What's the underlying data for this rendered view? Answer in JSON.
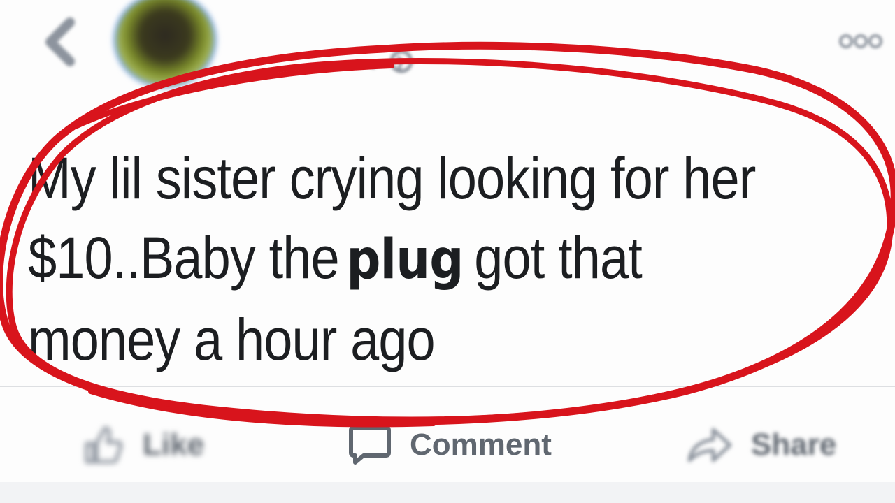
{
  "post": {
    "line1": "My lil sister crying looking for her",
    "line2_before": "$10..Baby the",
    "line2_emphasis": "plug",
    "line2_after": "got that",
    "line3": "money a hour ago"
  },
  "actions": {
    "like_label": "Like",
    "comment_label": "Comment",
    "share_label": "Share"
  },
  "icons": {
    "back": "chevron-left-icon",
    "avatar": "avatar",
    "audience": "globe-icon",
    "more": "more-icon",
    "like": "thumbs-up-icon",
    "comment": "comment-icon",
    "share": "share-arrow-icon"
  },
  "colors": {
    "text": "#1c1e21",
    "action_text": "#606770",
    "annotation_red": "#d8141c",
    "avatar_ring": "#7aa7df"
  }
}
